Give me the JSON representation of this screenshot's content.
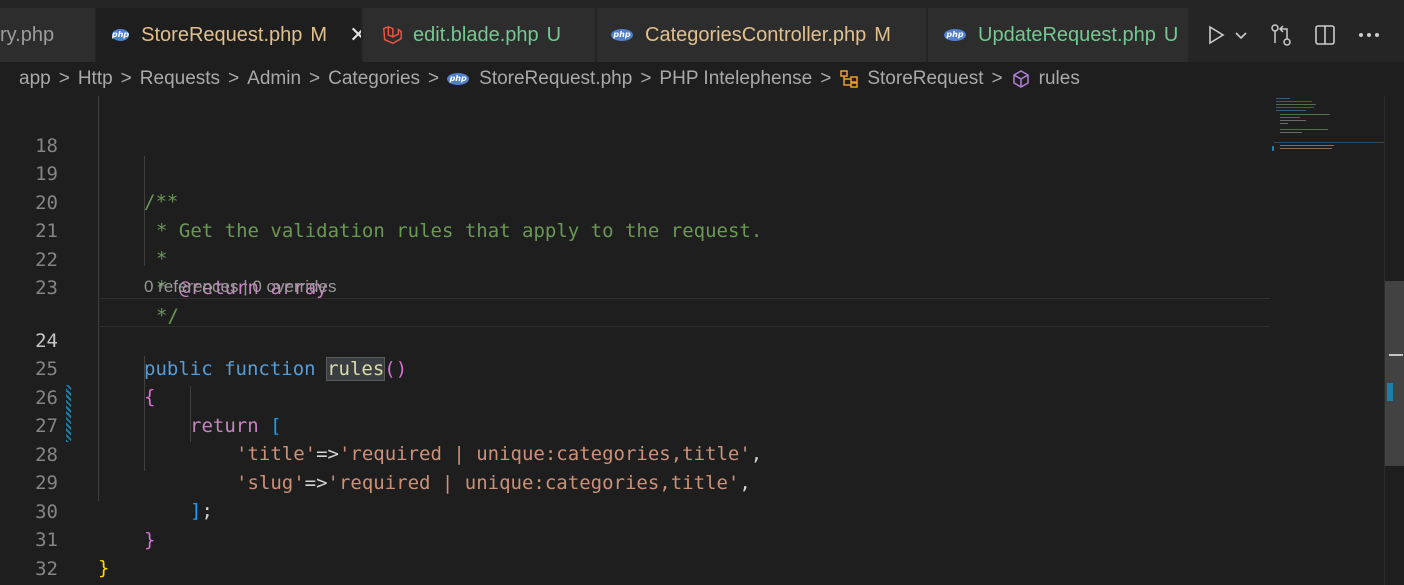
{
  "tabs": [
    {
      "label": "ry.php",
      "status": "",
      "kind": "plain"
    },
    {
      "label": "StoreRequest.php",
      "status": "M",
      "kind": "php",
      "active": true
    },
    {
      "label": "edit.blade.php",
      "status": "U",
      "kind": "blade"
    },
    {
      "label": "CategoriesController.php",
      "status": "M",
      "kind": "php"
    },
    {
      "label": "UpdateRequest.php",
      "status": "U",
      "kind": "php"
    }
  ],
  "tab_close_glyph": "✕",
  "tab_actions": [
    "run-icon",
    "chevron-down-icon",
    "compare-changes-icon",
    "split-editor-icon",
    "more-actions-icon"
  ],
  "breadcrumb": {
    "items": [
      "app",
      "Http",
      "Requests",
      "Admin",
      "Categories",
      "StoreRequest.php",
      "PHP Intelephense",
      "StoreRequest",
      "rules"
    ],
    "separator": ">"
  },
  "editor": {
    "codelens": {
      "references": "0 references",
      "divider": " | ",
      "overrides": "0 overrides"
    },
    "lines": [
      {
        "n": "18",
        "text": ""
      },
      {
        "n": "19",
        "text": "    /**"
      },
      {
        "n": "20",
        "text": "     * Get the validation rules that apply to the request."
      },
      {
        "n": "21",
        "text": "     *"
      },
      {
        "n": "22",
        "text": "     * @return array"
      },
      {
        "n": "23",
        "text": "     */"
      },
      {
        "n": "24",
        "text": "    public function rules()"
      },
      {
        "n": "25",
        "text": "    {"
      },
      {
        "n": "26",
        "text": "        return ["
      },
      {
        "n": "27",
        "text": "            'title'=>'required | unique:categories,title',"
      },
      {
        "n": "28",
        "text": "            'slug'=>'required | unique:categories,title',"
      },
      {
        "n": "29",
        "text": "        ];"
      },
      {
        "n": "30",
        "text": "    }"
      },
      {
        "n": "31",
        "text": "}"
      },
      {
        "n": "32",
        "text": ""
      }
    ],
    "tokens": {
      "l19": "/**",
      "l20": "* Get the validation rules that apply to the request.",
      "l21": "*",
      "l22_star": "* ",
      "l22_tag": "@return",
      "l22_type": "array",
      "l23": "*/",
      "l24_kw1": "public",
      "l24_kw2": "function",
      "l24_fn": "rules",
      "l24_parens": "()",
      "l25": "{",
      "l26_kw": "return",
      "l26_br": "[",
      "l27_k": "'title'",
      "l27_op": "=>",
      "l27_v": "'required | unique:categories,title'",
      "l27_c": ",",
      "l28_k": "'slug'",
      "l28_op": "=>",
      "l28_v": "'required | unique:categories,title'",
      "l28_c": ",",
      "l29_br": "]",
      "l29_semi": ";",
      "l30": "}",
      "l31": "}"
    },
    "current_line": "24"
  },
  "colors": {
    "modified": "#e2c08d",
    "untracked": "#73c991",
    "keyword": "#569cd6",
    "string": "#ce9178",
    "comment": "#6a9955"
  }
}
